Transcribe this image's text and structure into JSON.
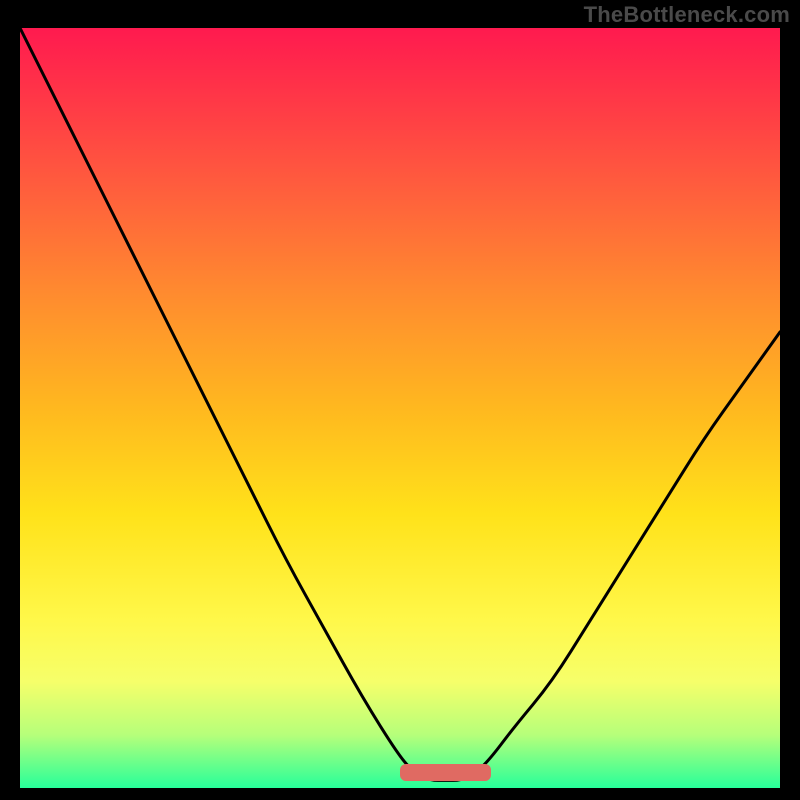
{
  "watermark": "TheBottleneck.com",
  "chart_data": {
    "type": "line",
    "title": "",
    "xlabel": "",
    "ylabel": "",
    "xlim": [
      0,
      100
    ],
    "ylim": [
      0,
      100
    ],
    "x": [
      0,
      5,
      10,
      15,
      20,
      25,
      30,
      35,
      40,
      45,
      50,
      52,
      54,
      56,
      58,
      60,
      62,
      65,
      70,
      75,
      80,
      85,
      90,
      95,
      100
    ],
    "y": [
      100,
      90,
      80,
      70,
      60,
      50,
      40,
      30,
      21,
      12,
      4,
      2,
      1,
      1,
      1,
      2,
      4,
      8,
      14,
      22,
      30,
      38,
      46,
      53,
      60
    ],
    "optimal_band": {
      "x_start": 50,
      "x_end": 62,
      "y": 2,
      "thickness": 2.2
    },
    "gradient_stops": [
      {
        "pos": 0.0,
        "color": "#ff1a4f"
      },
      {
        "pos": 0.08,
        "color": "#ff3348"
      },
      {
        "pos": 0.2,
        "color": "#ff5a3e"
      },
      {
        "pos": 0.35,
        "color": "#ff8b2f"
      },
      {
        "pos": 0.5,
        "color": "#ffb81f"
      },
      {
        "pos": 0.64,
        "color": "#ffe21a"
      },
      {
        "pos": 0.78,
        "color": "#fff84a"
      },
      {
        "pos": 0.86,
        "color": "#f6ff6a"
      },
      {
        "pos": 0.93,
        "color": "#b6ff7a"
      },
      {
        "pos": 1.0,
        "color": "#27ff9a"
      }
    ]
  }
}
